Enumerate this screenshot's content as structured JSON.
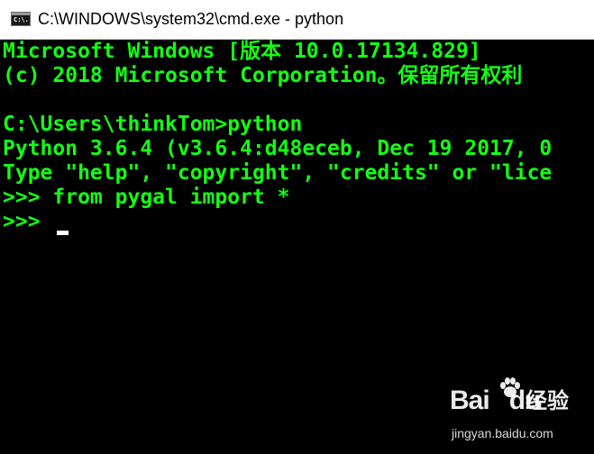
{
  "window": {
    "title": "C:\\WINDOWS\\system32\\cmd.exe - python",
    "icon": "console-icon",
    "icon_glyph": "C:\\."
  },
  "console": {
    "lines": [
      "Microsoft Windows [版本 10.0.17134.829]",
      "(c) 2018 Microsoft Corporation。保留所有权利",
      "",
      "C:\\Users\\thinkTom>python",
      "Python 3.6.4 (v3.6.4:d48eceb, Dec 19 2017, 0",
      "Type \"help\", \"copyright\", \"credits\" or \"lice",
      ">>> from pygal import *",
      ">>> "
    ],
    "text_color": "#13ff13",
    "background": "#000000"
  },
  "watermark": {
    "logo_text": "Bai",
    "logo_text_2": "du",
    "brand": "经验",
    "url": "jingyan.baidu.com"
  }
}
